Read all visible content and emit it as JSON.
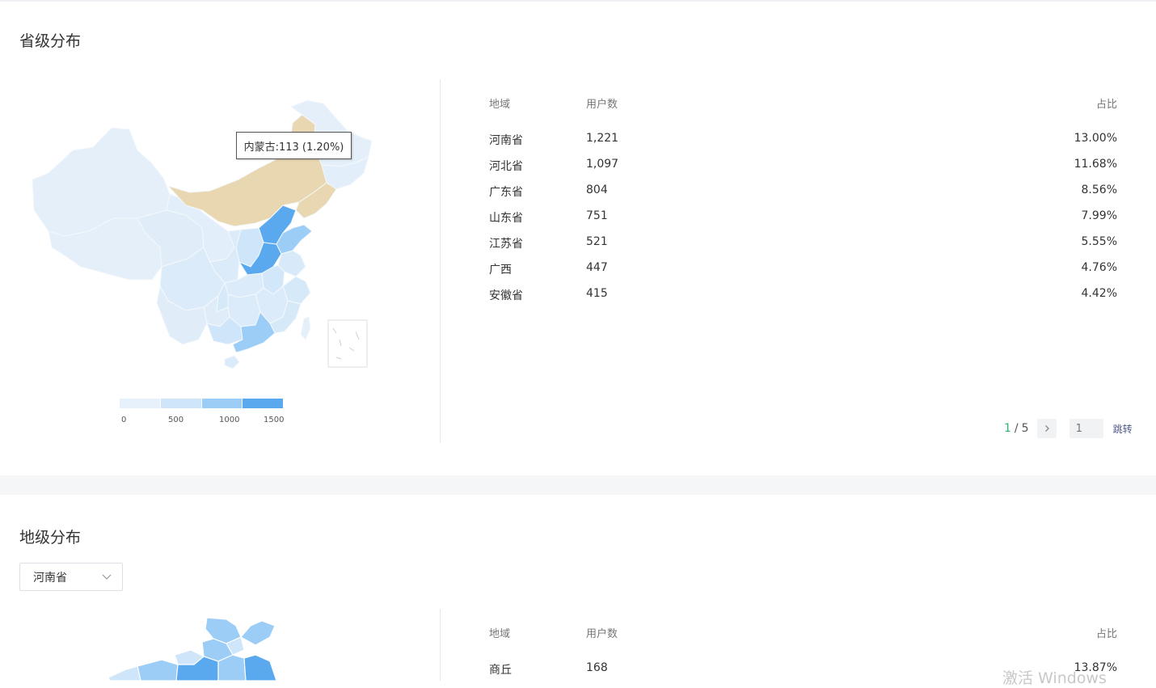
{
  "province_section": {
    "title": "省级分布",
    "table": {
      "headers": {
        "region": "地域",
        "users": "用户数",
        "share": "占比"
      },
      "rows": [
        {
          "region": "河南省",
          "users": "1,221",
          "share": "13.00%"
        },
        {
          "region": "河北省",
          "users": "1,097",
          "share": "11.68%"
        },
        {
          "region": "广东省",
          "users": "804",
          "share": "8.56%"
        },
        {
          "region": "山东省",
          "users": "751",
          "share": "7.99%"
        },
        {
          "region": "江苏省",
          "users": "521",
          "share": "5.55%"
        },
        {
          "region": "广西",
          "users": "447",
          "share": "4.76%"
        },
        {
          "region": "安徽省",
          "users": "415",
          "share": "4.42%"
        }
      ]
    },
    "pager": {
      "current": "1",
      "separator": "/",
      "total": "5",
      "next_icon": "chevron-right-icon",
      "jump_value": "1",
      "jump_label": "跳转"
    },
    "map": {
      "tooltip": "内蒙古:113 (1.20%)",
      "legend_ticks": [
        "0",
        "500",
        "1000",
        "1500"
      ],
      "legend_colors": [
        "#e6f1fc",
        "#cfe5fa",
        "#9ccdf6",
        "#5aa9ee"
      ],
      "highlight_color": "#e8d7b0"
    }
  },
  "city_section": {
    "title": "地级分布",
    "select_value": "河南省",
    "select_icon": "chevron-down-icon",
    "table": {
      "headers": {
        "region": "地域",
        "users": "用户数",
        "share": "占比"
      },
      "rows": [
        {
          "region": "商丘",
          "users": "168",
          "share": "13.87%"
        }
      ]
    }
  },
  "watermark": "激活 Windows"
}
